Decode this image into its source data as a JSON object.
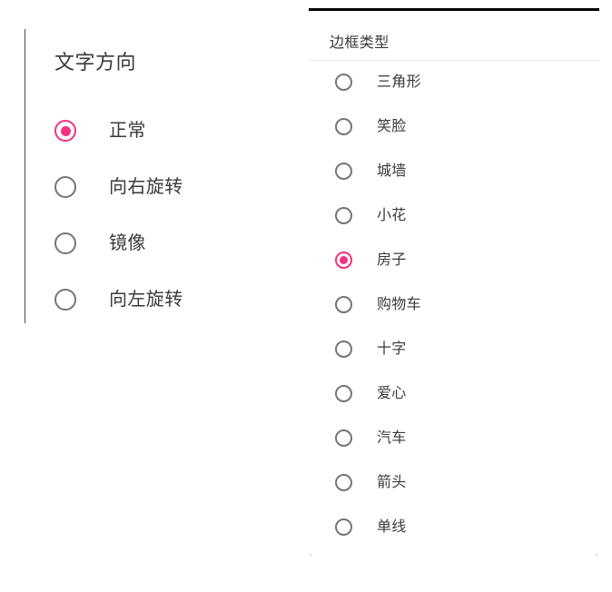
{
  "theme": {
    "background": "#ffffff",
    "accent": "#f5317f",
    "radio_unselected": "#757575",
    "text": "#3a3a3a",
    "topbar": "#000000",
    "divider": "#e8e8e8",
    "left_rule": "#4a4a4a"
  },
  "left_panel": {
    "heading": "文字方向",
    "selected_value": "正常",
    "options": [
      {
        "label": "正常",
        "selected": true
      },
      {
        "label": "向右旋转",
        "selected": false
      },
      {
        "label": "镜像",
        "selected": false
      },
      {
        "label": "向左旋转",
        "selected": false
      }
    ]
  },
  "right_panel": {
    "heading": "边框类型",
    "selected_value": "房子",
    "options": [
      {
        "label": "三角形",
        "selected": false
      },
      {
        "label": "笑脸",
        "selected": false
      },
      {
        "label": "城墙",
        "selected": false
      },
      {
        "label": "小花",
        "selected": false
      },
      {
        "label": "房子",
        "selected": true
      },
      {
        "label": "购物车",
        "selected": false
      },
      {
        "label": "十字",
        "selected": false
      },
      {
        "label": "爱心",
        "selected": false
      },
      {
        "label": "汽车",
        "selected": false
      },
      {
        "label": "箭头",
        "selected": false
      },
      {
        "label": "单线",
        "selected": false
      }
    ]
  }
}
